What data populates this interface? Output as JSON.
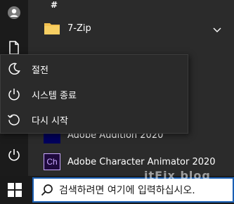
{
  "all_apps": {
    "section_header": "#",
    "items": [
      {
        "label": "7-Zip"
      },
      {
        "label": "Adobe Audition 2020"
      },
      {
        "label": "Adobe Character Animator 2020",
        "tile_text": "Ch"
      }
    ]
  },
  "power_menu": {
    "items": [
      {
        "label": "절전"
      },
      {
        "label": "시스템 종료"
      },
      {
        "label": "다시 시작"
      }
    ]
  },
  "taskbar": {
    "search_placeholder": "검색하려면 여기에 입력하십시오."
  },
  "watermark": {
    "text": "itFix blog"
  },
  "colors": {
    "accent": "#1a5fb4",
    "folder": "#f2c04f",
    "character_animator_tile": "#1f0a3d",
    "character_animator_text": "#c9a7ff"
  }
}
